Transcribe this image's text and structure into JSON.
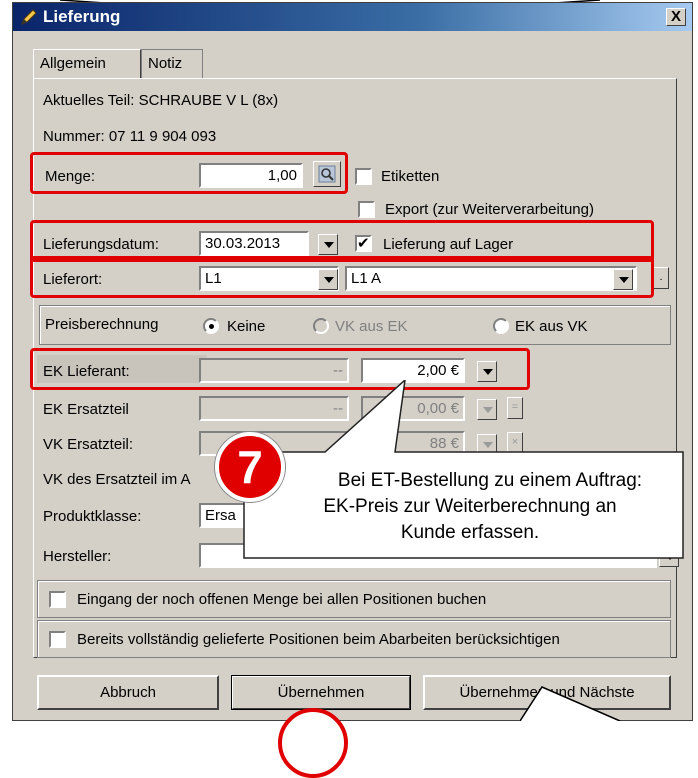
{
  "window": {
    "title": "Lieferung",
    "close_symbol": "X"
  },
  "tabs": [
    {
      "label": "Allgemein"
    },
    {
      "label": "Notiz"
    }
  ],
  "info": {
    "part": "Aktuelles Teil: SCHRAUBE V L (8x)",
    "number": "Nummer: 07 11 9 904 093"
  },
  "menge": {
    "label": "Menge:",
    "value": "1,00"
  },
  "etiketten": {
    "label": "Etiketten",
    "checked": false
  },
  "export": {
    "label": "Export (zur Weiterverarbeitung)",
    "checked": false
  },
  "lieferungsdatum": {
    "label": "Lieferungsdatum:",
    "value": "30.03.2013"
  },
  "lieferung_lager": {
    "label": "Lieferung auf Lager",
    "checked": true
  },
  "lieferort": {
    "label": "Lieferort:",
    "value1": "L1",
    "value2": "L1 A",
    "extra_btn": "."
  },
  "preisberechnung": {
    "label": "Preisberechnung",
    "options": [
      "Keine",
      "VK aus EK",
      "EK aus VK"
    ],
    "selected": "Keine"
  },
  "ek_lieferant": {
    "label": "EK Lieferant:",
    "dash": "--",
    "value": "2,00 €"
  },
  "ek_ersatzteil": {
    "label": "EK Ersatzteil",
    "dash": "--",
    "value": "0,00 €",
    "btn": "="
  },
  "vk_ersatzteil": {
    "label": "VK Ersatzteil:",
    "value": "88 €",
    "btn": "×"
  },
  "vk_auftrag": {
    "label": "VK des Ersatzteil im A"
  },
  "produktklasse": {
    "label": "Produktklasse:",
    "value": "Ersa"
  },
  "hersteller": {
    "label": "Hersteller:",
    "value": ""
  },
  "options": {
    "eingang": "Eingang der noch offenen Menge bei allen Positionen buchen",
    "bereits": "Bereits vollständig gelieferte Positionen beim Abarbeiten berücksichtigen"
  },
  "buttons": {
    "abbruch": "Abbruch",
    "uebernehmen": "Übernehmen",
    "uebernehmen_naechste": "Übernehmen und Nächste"
  },
  "annotation": {
    "step": "7",
    "line1": "Bei ET-Bestellung zu einem Auftrag:",
    "line2": "EK-Preis zur  Weiterberechnung an",
    "line3": "Kunde erfassen."
  },
  "colors": {
    "highlight": "#e00000",
    "title_bar": "#0a246a",
    "dialog_bg": "#d4d0c8"
  },
  "icons": [
    "pencil-icon",
    "close-icon",
    "lookup-icon",
    "dropdown-icon"
  ]
}
